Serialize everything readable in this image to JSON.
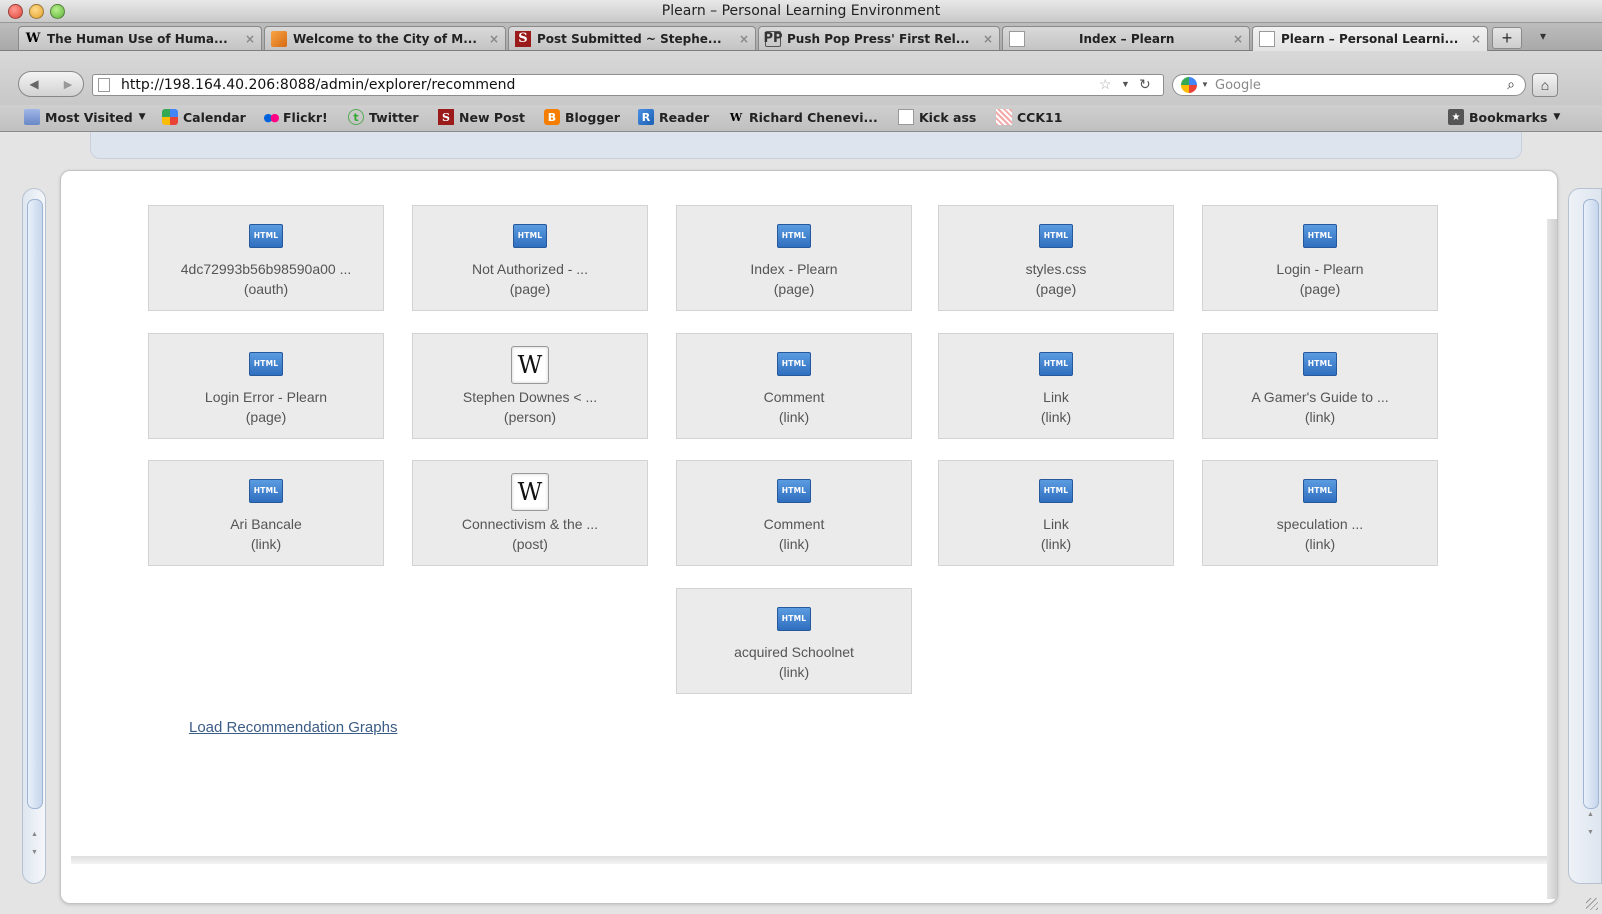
{
  "window": {
    "title": "Plearn – Personal Learning Environment"
  },
  "tabs": [
    {
      "label": "The Human Use of Huma...",
      "icon": "wikipedia-icon"
    },
    {
      "label": "Welcome to the City of M...",
      "icon": "city-icon"
    },
    {
      "label": "Post Submitted ~ Stephe...",
      "icon": "stephens-web-icon"
    },
    {
      "label": "Push Pop Press' First Rel...",
      "icon": "pushpop-icon"
    },
    {
      "label": "Index – Plearn",
      "icon": "page-icon"
    },
    {
      "label": "Plearn – Personal Learni...",
      "icon": "page-icon",
      "active": true
    }
  ],
  "tab_close": "×",
  "new_tab": "+",
  "nav": {
    "url": "http://198.164.40.206:8088/admin/explorer/recommend",
    "search_placeholder": "Google"
  },
  "bookmarks": [
    {
      "label": "Most Visited",
      "icon": "folder-icon",
      "dropdown": true
    },
    {
      "label": "Calendar",
      "icon": "google-calendar-icon"
    },
    {
      "label": "Flickr!",
      "icon": "flickr-icon"
    },
    {
      "label": "Twitter",
      "icon": "twitter-icon"
    },
    {
      "label": "New Post",
      "icon": "stephens-web-icon"
    },
    {
      "label": "Blogger",
      "icon": "blogger-icon"
    },
    {
      "label": "Reader",
      "icon": "reader-icon"
    },
    {
      "label": "Richard Chenevi...",
      "icon": "wikipedia-icon"
    },
    {
      "label": "Kick ass",
      "icon": "page-icon"
    },
    {
      "label": "CCK11",
      "icon": "cck11-icon"
    }
  ],
  "bookmarks_menu": "Bookmarks",
  "recommendations": [
    {
      "name": "4dc72993b56b98590a00 ...",
      "type": "(oauth)",
      "icon": "html-icon"
    },
    {
      "name": "Not Authorized - ...",
      "type": "(page)",
      "icon": "html-icon"
    },
    {
      "name": "Index - Plearn",
      "type": "(page)",
      "icon": "html-icon"
    },
    {
      "name": "styles.css",
      "type": "(page)",
      "icon": "html-icon"
    },
    {
      "name": "Login - Plearn",
      "type": "(page)",
      "icon": "html-icon"
    },
    {
      "name": "Login Error - Plearn",
      "type": "(page)",
      "icon": "html-icon"
    },
    {
      "name": "Stephen Downes < ...",
      "type": "(person)",
      "icon": "wikipedia-icon"
    },
    {
      "name": "Comment",
      "type": "(link)",
      "icon": "html-icon"
    },
    {
      "name": "Link",
      "type": "(link)",
      "icon": "html-icon"
    },
    {
      "name": "A Gamer's Guide to ...",
      "type": "(link)",
      "icon": "html-icon"
    },
    {
      "name": "Ari Bancale",
      "type": "(link)",
      "icon": "html-icon"
    },
    {
      "name": "Connectivism & the ...",
      "type": "(post)",
      "icon": "wikipedia-icon"
    },
    {
      "name": "Comment",
      "type": "(link)",
      "icon": "html-icon"
    },
    {
      "name": "Link",
      "type": "(link)",
      "icon": "html-icon"
    },
    {
      "name": "speculation ...",
      "type": "(link)",
      "icon": "html-icon"
    },
    {
      "name": "acquired Schoolnet",
      "type": "(link)",
      "icon": "html-icon"
    }
  ],
  "html_icon_label": "HTML",
  "wiki_icon_label": "W",
  "load_link": "Load Recommendation Graphs"
}
